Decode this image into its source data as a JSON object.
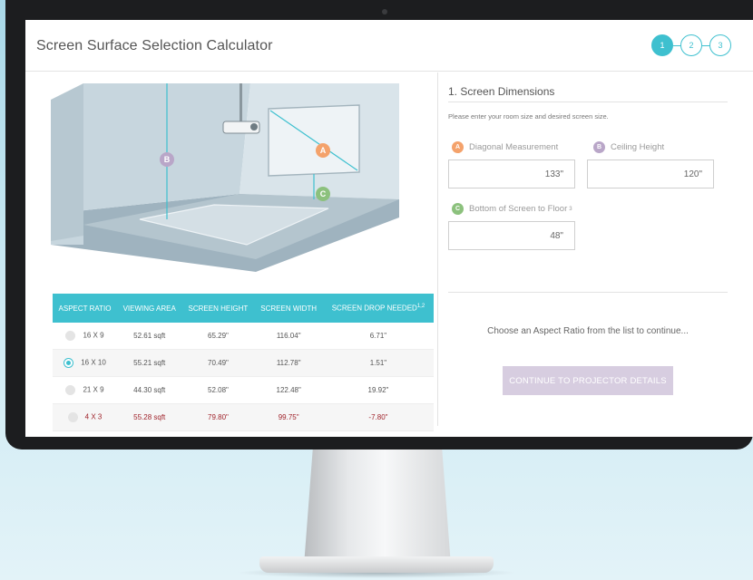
{
  "app": {
    "title": "Screen Surface Selection Calculator"
  },
  "steps": [
    "1",
    "2",
    "3"
  ],
  "diagram": {
    "badge_a": "A",
    "badge_b": "B",
    "badge_c": "C"
  },
  "table": {
    "headers": [
      "ASPECT RATIO",
      "VIEWING AREA",
      "SCREEN HEIGHT",
      "SCREEN WIDTH",
      "SCREEN DROP NEEDED"
    ],
    "drop_note": "1,2",
    "rows": [
      {
        "ratio": "16 X 9",
        "area": "52.61 sqft",
        "height": "65.29\"",
        "width": "116.04\"",
        "drop": "6.71\""
      },
      {
        "ratio": "16 X 10",
        "area": "55.21 sqft",
        "height": "70.49\"",
        "width": "112.78\"",
        "drop": "1.51\""
      },
      {
        "ratio": "21 X 9",
        "area": "44.30 sqft",
        "height": "52.08\"",
        "width": "122.48\"",
        "drop": "19.92\""
      },
      {
        "ratio": "4 X 3",
        "area": "55.28 sqft",
        "height": "79.80\"",
        "width": "99.75\"",
        "drop": "-7.80\""
      }
    ]
  },
  "dimensions": {
    "title": "1. Screen Dimensions",
    "hint": "Please enter your room size and desired screen size.",
    "diagonal": {
      "badge": "A",
      "label": "Diagonal Measurement",
      "value": "133\""
    },
    "ceiling": {
      "badge": "B",
      "label": "Ceiling Height",
      "value": "120\""
    },
    "bottom": {
      "badge": "C",
      "label": "Bottom of Screen to Floor",
      "note": "3",
      "value": "48\""
    }
  },
  "message": "Choose an Aspect Ratio from the list to continue...",
  "continue_label": "CONTINUE TO PROJECTOR DETAILS",
  "colors": {
    "accent": "#3ec0cf",
    "badge_a": "#f4a26b",
    "badge_b": "#b9a6c8",
    "badge_c": "#8cc17d",
    "warn": "#a0242c",
    "button": "#d7cde0"
  }
}
